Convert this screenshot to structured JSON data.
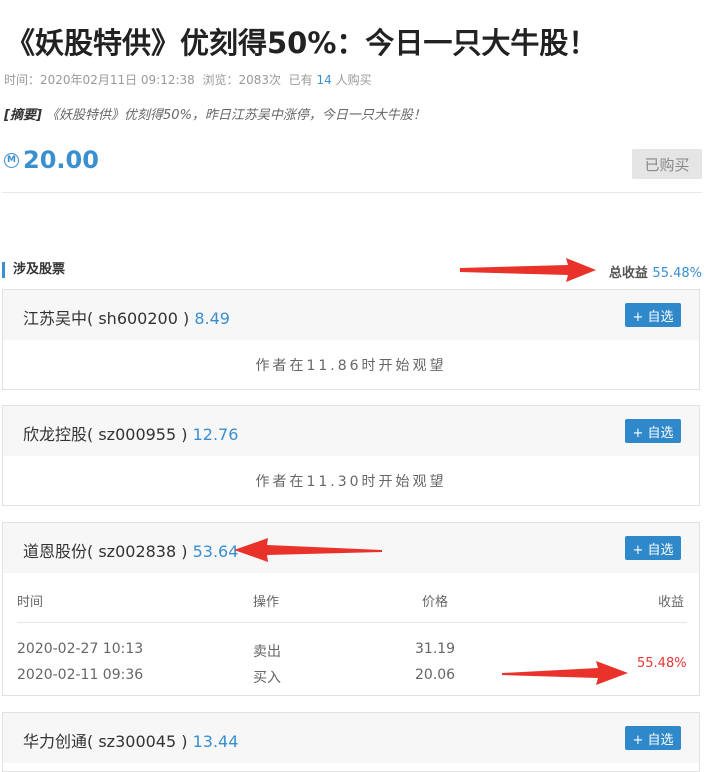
{
  "article": {
    "title": "《妖股特供》优刻得50%：今日一只大牛股！",
    "time_label": "时间：",
    "time": "2020年02月11日 09:12:38",
    "views_label": "浏览：",
    "views": "2083次",
    "bought_prefix": "已有",
    "bought_count": "14",
    "bought_suffix": "人购买",
    "summary_tag": "[摘要]",
    "summary": "《妖股特供》优刻得50%，昨日江苏吴中涨停，今日一只大牛股！",
    "currency_icon": "Ⓜ",
    "price": "20.00",
    "bought_button": "已购买"
  },
  "stocks_section": {
    "heading": "涉及股票",
    "total_label": "总收益",
    "total_value": "55.48%"
  },
  "stocks": [
    {
      "name": "江苏吴中",
      "code": "sh600200",
      "price": "8.49",
      "add": "+ 自选",
      "note": "作者在11.86时开始观望"
    },
    {
      "name": "欣龙控股",
      "code": "sz000955",
      "price": "12.76",
      "add": "+ 自选",
      "note": "作者在11.30时开始观望"
    },
    {
      "name": "道恩股份",
      "code": "sz002838",
      "price": "53.64",
      "add": "+ 自选"
    },
    {
      "name": "华力创通",
      "code": "sz300045",
      "price": "13.44",
      "add": "+ 自选"
    }
  ],
  "trades": {
    "headers": {
      "time": "时间",
      "op": "操作",
      "price": "价格",
      "gain": "收益"
    },
    "rows": [
      {
        "time": "2020-02-27 10:13",
        "op": "卖出",
        "price": "31.19"
      },
      {
        "time": "2020-02-11 09:36",
        "op": "买入",
        "price": "20.06"
      }
    ],
    "gain": "55.48%"
  },
  "colors": {
    "accent": "#3a8fd0",
    "gain": "#e33333",
    "arrow": "#e8322a"
  }
}
